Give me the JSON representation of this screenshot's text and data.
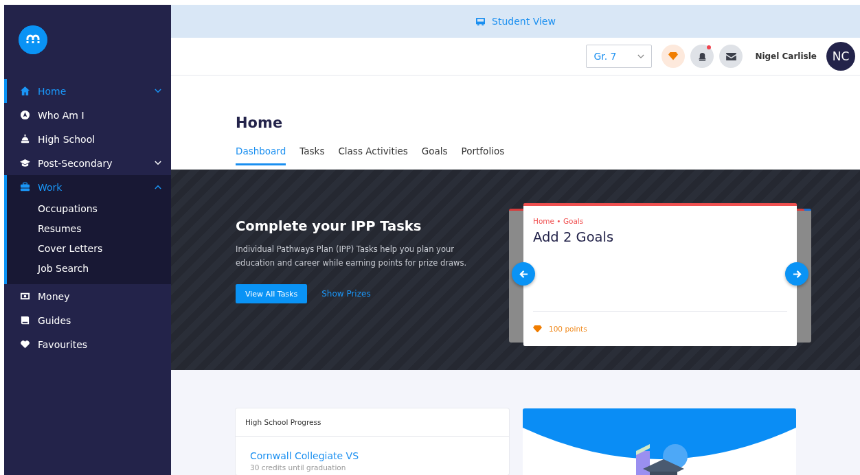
{
  "banner_bar": {
    "label": "Student View"
  },
  "sidebar": {
    "items": [
      {
        "label": "Home",
        "kind": "group",
        "selected": true,
        "expanded": false
      },
      {
        "label": "Who Am I",
        "kind": "link",
        "selected": false
      },
      {
        "label": "High School",
        "kind": "link",
        "selected": false
      },
      {
        "label": "Post-Secondary",
        "kind": "group",
        "selected": false,
        "expanded": false
      },
      {
        "label": "Work",
        "kind": "group",
        "selected": true,
        "expanded": true,
        "children": [
          {
            "label": "Occupations"
          },
          {
            "label": "Resumes"
          },
          {
            "label": "Cover Letters"
          },
          {
            "label": "Job Search"
          }
        ]
      },
      {
        "label": "Money",
        "kind": "link",
        "selected": false
      },
      {
        "label": "Guides",
        "kind": "link",
        "selected": false
      },
      {
        "label": "Favourites",
        "kind": "link",
        "selected": false
      }
    ]
  },
  "header": {
    "grade": "Gr. 7",
    "notifications_unread": true,
    "user_name": "Nigel Carlisle",
    "avatar_initials": "NC"
  },
  "page": {
    "title": "Home",
    "tabs": [
      {
        "label": "Dashboard",
        "selected": true
      },
      {
        "label": "Tasks",
        "selected": false
      },
      {
        "label": "Class Activities",
        "selected": false
      },
      {
        "label": "Goals",
        "selected": false
      },
      {
        "label": "Portfolios",
        "selected": false
      }
    ]
  },
  "ipp_banner": {
    "title": "Complete your IPP Tasks",
    "description": "Individual Pathways Plan (IPP) Tasks help you plan your education and career while earning points for prize draws.",
    "primary_button": "View All Tasks",
    "secondary_link": "Show Prizes",
    "task_card": {
      "breadcrumb": "Home • Goals",
      "title": "Add 2 Goals",
      "points": "100 points"
    }
  },
  "progress_card": {
    "title": "High School Progress",
    "school": "Cornwall Collegiate VS",
    "subtitle": "30 credits until graduation"
  }
}
